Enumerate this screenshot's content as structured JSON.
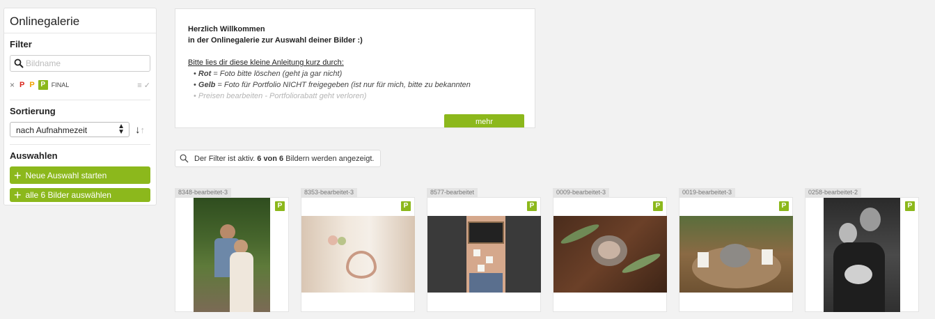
{
  "sidebar": {
    "title": "Onlinegalerie",
    "filter": {
      "heading": "Filter",
      "search_placeholder": "Bildname",
      "clear": "×",
      "flag_red": "P",
      "flag_yellow": "P",
      "flag_green": "P",
      "final_label": "FINAL"
    },
    "sort": {
      "heading": "Sortierung",
      "selected": "nach Aufnahmezeit"
    },
    "select": {
      "heading": "Auswahlen",
      "new_selection": "Neue Auswahl starten",
      "select_all": "alle 6 Bilder auswählen"
    }
  },
  "welcome": {
    "line1": "Herzlich Willkommen",
    "line2": "in der Onlinegalerie zur Auswahl deiner Bilder :)",
    "intro": "Bitte lies dir diese kleine Anleitung kurz durch:",
    "rot_label": "Rot",
    "rot_text": " = Foto bitte löschen (geht ja gar nicht)",
    "gelb_label": "Gelb",
    "gelb_text": " = Foto für Portfolio NICHT freigegeben (ist nur für mich, bitte zu bekannten",
    "gelb_text2": "Preisen bearbeiten - Portfoliorabatt geht verloren)",
    "more_button": "mehr"
  },
  "notice": {
    "prefix": "Der Filter ist aktiv.",
    "count": "6 von 6",
    "suffix": "Bildern werden angezeigt."
  },
  "thumbnails": [
    {
      "name": "8348-bearbeitet-3",
      "flag": "P"
    },
    {
      "name": "8353-bearbeitet-3",
      "flag": "P"
    },
    {
      "name": "8577-bearbeitet",
      "flag": "P"
    },
    {
      "name": "0009-bearbeitet-3",
      "flag": "P"
    },
    {
      "name": "0019-bearbeitet-3",
      "flag": "P"
    },
    {
      "name": "0258-bearbeitet-2",
      "flag": "P"
    }
  ],
  "colors": {
    "accent_green": "#8cb81c",
    "flag_red": "#d9261c",
    "flag_yellow": "#f0a000"
  }
}
